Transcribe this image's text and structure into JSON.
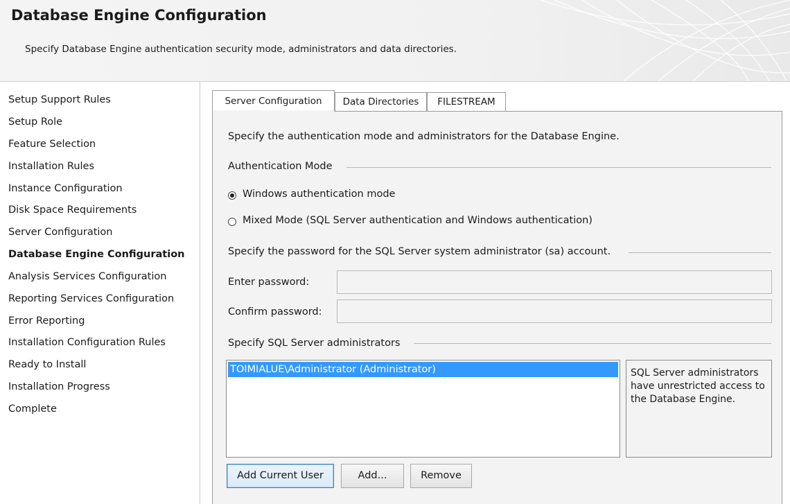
{
  "header": {
    "title": "Database Engine Configuration",
    "subtitle": "Specify Database Engine authentication security mode, administrators and data directories."
  },
  "nav": {
    "items": [
      {
        "label": "Setup Support Rules",
        "active": false
      },
      {
        "label": "Setup Role",
        "active": false
      },
      {
        "label": "Feature Selection",
        "active": false
      },
      {
        "label": "Installation Rules",
        "active": false
      },
      {
        "label": "Instance Configuration",
        "active": false
      },
      {
        "label": "Disk Space Requirements",
        "active": false
      },
      {
        "label": "Server Configuration",
        "active": false
      },
      {
        "label": "Database Engine Configuration",
        "active": true
      },
      {
        "label": "Analysis Services Configuration",
        "active": false
      },
      {
        "label": "Reporting Services Configuration",
        "active": false
      },
      {
        "label": "Error Reporting",
        "active": false
      },
      {
        "label": "Installation Configuration Rules",
        "active": false
      },
      {
        "label": "Ready to Install",
        "active": false
      },
      {
        "label": "Installation Progress",
        "active": false
      },
      {
        "label": "Complete",
        "active": false
      }
    ]
  },
  "tabs": [
    {
      "label": "Server Configuration",
      "selected": true
    },
    {
      "label": "Data Directories",
      "selected": false
    },
    {
      "label": "FILESTREAM",
      "selected": false
    }
  ],
  "server_config": {
    "intro": "Specify the authentication mode and administrators for the Database Engine.",
    "auth_group_label": "Authentication Mode",
    "radio_windows_label": "Windows authentication mode",
    "radio_mixed_label": "Mixed Mode (SQL Server authentication and Windows authentication)",
    "selected_mode": "windows",
    "password_group_label": "Specify the password for the SQL Server system administrator (sa) account.",
    "enter_password_label": "Enter password:",
    "enter_password_value": "",
    "confirm_password_label": "Confirm password:",
    "confirm_password_value": "",
    "admins_group_label": "Specify SQL Server administrators",
    "admins": [
      "TOIMIALUE\\Administrator (Administrator)"
    ],
    "admins_info": "SQL Server administrators have unrestricted access to the Database Engine.",
    "buttons": {
      "add_current_user": "Add Current User",
      "add": "Add...",
      "remove": "Remove"
    }
  },
  "colors": {
    "selection": "#3399ff",
    "panel_background": "#f3f3f3"
  }
}
